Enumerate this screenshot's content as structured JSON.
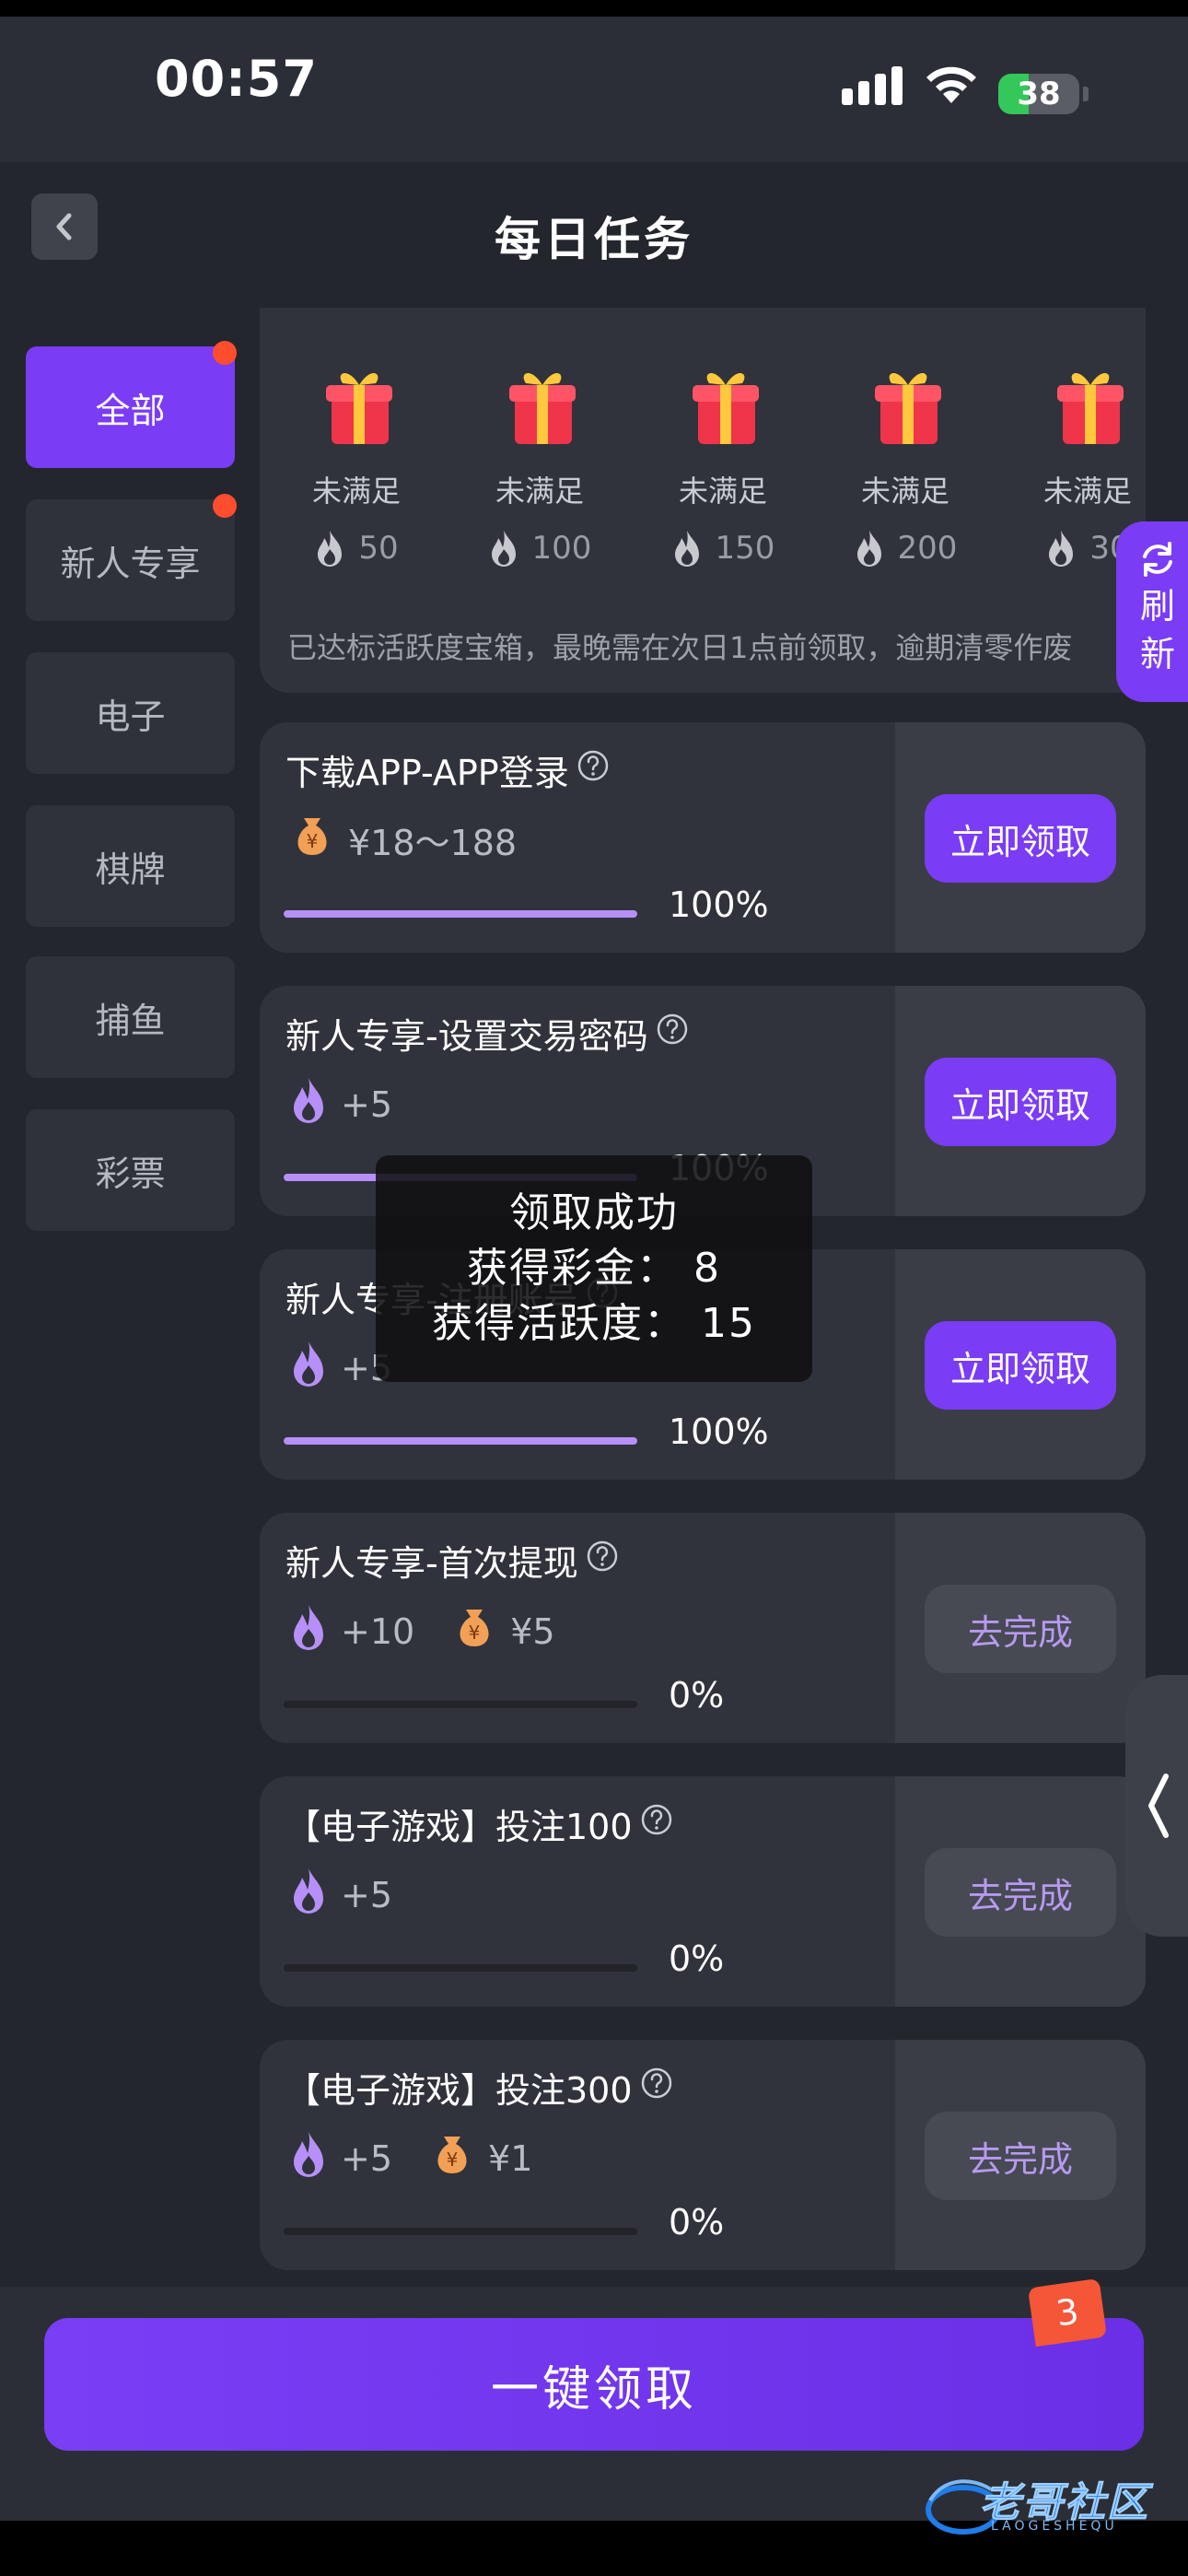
{
  "status_bar": {
    "time": "00:57",
    "battery": "38",
    "battery_level": 0.38
  },
  "header": {
    "title": "每日任务"
  },
  "sidebar": {
    "items": [
      {
        "label": "全部",
        "active": true,
        "dot": true
      },
      {
        "label": "新人专享",
        "active": false,
        "dot": true
      },
      {
        "label": "电子",
        "active": false,
        "dot": false
      },
      {
        "label": "棋牌",
        "active": false,
        "dot": false
      },
      {
        "label": "捕鱼",
        "active": false,
        "dot": false
      },
      {
        "label": "彩票",
        "active": false,
        "dot": false
      }
    ]
  },
  "reward_boxes": {
    "items": [
      {
        "status": "未满足",
        "score": "50"
      },
      {
        "status": "未满足",
        "score": "100"
      },
      {
        "status": "未满足",
        "score": "150"
      },
      {
        "status": "未满足",
        "score": "200"
      },
      {
        "status": "未满足",
        "score": "30"
      }
    ],
    "note": "已达标活跃度宝箱，最晚需在次日1点前领取，逾期清零作废"
  },
  "refresh": {
    "line1": "刷",
    "line2": "新"
  },
  "tasks": [
    {
      "title": "下载APP-APP登录",
      "flame": "",
      "money": "¥18～188",
      "progress": "100%",
      "progress_value": 1.0,
      "button": "立即领取",
      "button_type": "claim"
    },
    {
      "title": "新人专享-设置交易密码",
      "flame": "+5",
      "money": "",
      "progress": "100%",
      "progress_value": 1.0,
      "button": "立即领取",
      "button_type": "claim"
    },
    {
      "title": "新人专享-注册账号",
      "flame": "+5",
      "money": "",
      "progress": "100%",
      "progress_value": 1.0,
      "button": "立即领取",
      "button_type": "claim"
    },
    {
      "title": "新人专享-首次提现",
      "flame": "+10",
      "money": "¥5",
      "progress": "0%",
      "progress_value": 0.0,
      "button": "去完成",
      "button_type": "go"
    },
    {
      "title": "【电子游戏】投注100",
      "flame": "+5",
      "money": "",
      "progress": "0%",
      "progress_value": 0.0,
      "button": "去完成",
      "button_type": "go"
    },
    {
      "title": "【电子游戏】投注300",
      "flame": "+5",
      "money": "¥1",
      "progress": "0%",
      "progress_value": 0.0,
      "button": "去完成",
      "button_type": "go"
    }
  ],
  "toast": {
    "line1": "领取成功",
    "line2": "获得彩金：  8",
    "line3": "获得活跃度：  15"
  },
  "bottom": {
    "claim_all": "一键领取",
    "badge": "3"
  },
  "watermark": {
    "text": "老哥社区",
    "sub": "LAOGESHEQU"
  },
  "colors": {
    "accent": "#7b3cf5",
    "background": "#24262d",
    "card": "#30333b",
    "dot": "#ff4d2e",
    "progress": "#b690f8"
  }
}
